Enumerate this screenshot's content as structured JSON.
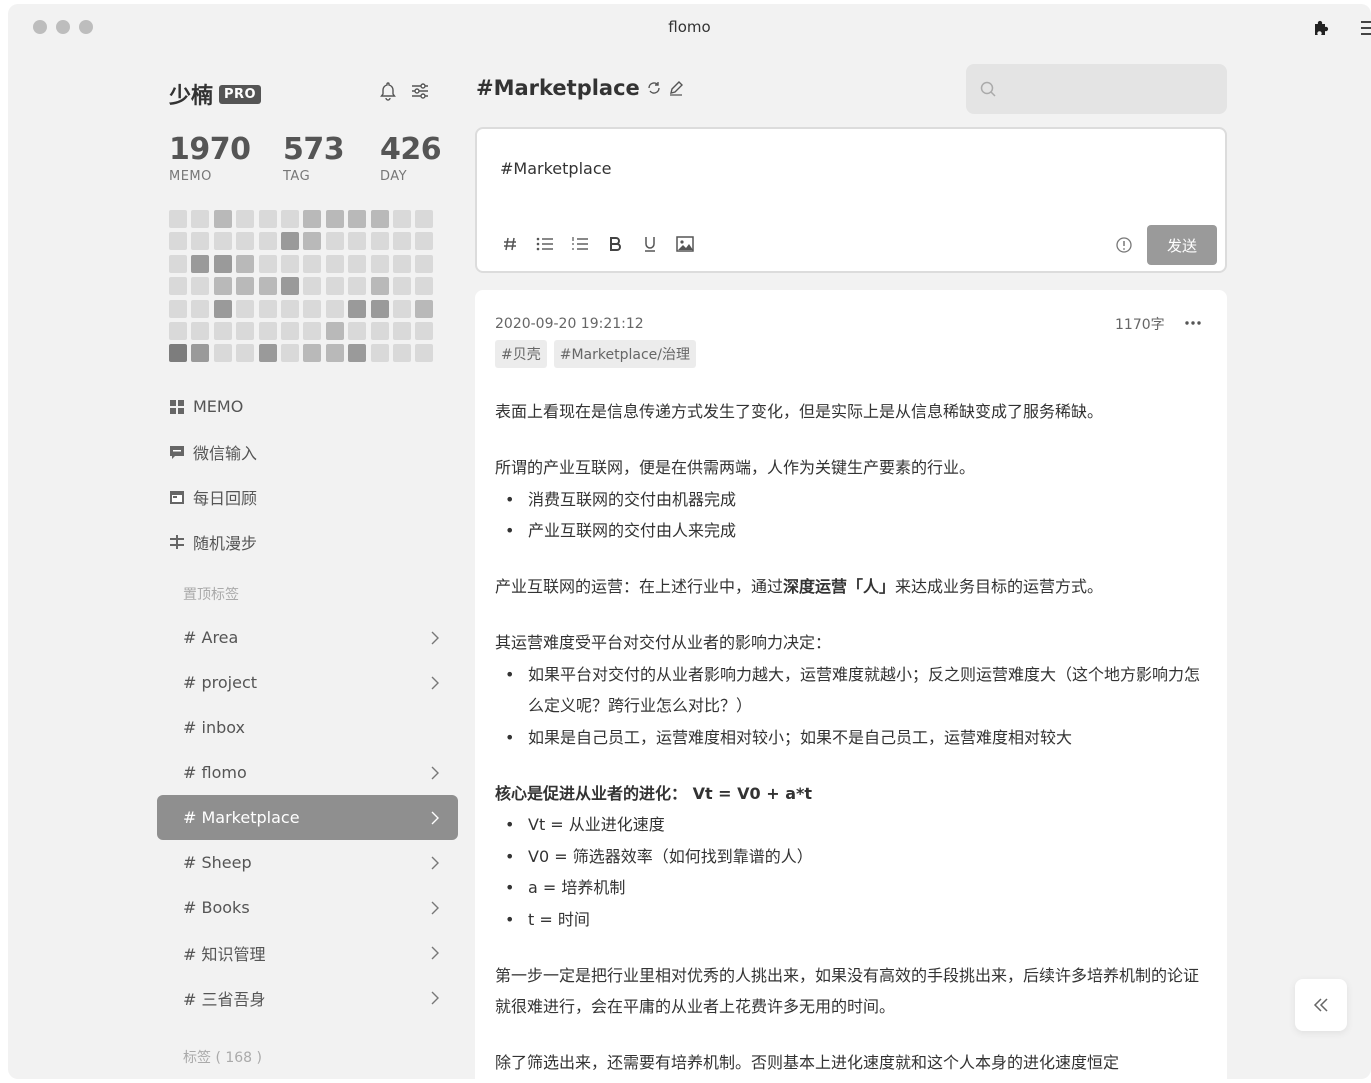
{
  "window": {
    "title": "flomo"
  },
  "sidebar": {
    "user_name": "少楠",
    "badge": "PRO",
    "stats": [
      {
        "value": "1970",
        "label": "MEMO"
      },
      {
        "value": "573",
        "label": "TAG"
      },
      {
        "value": "426",
        "label": "DAY"
      }
    ],
    "heatmap": {
      "colors": [
        "#e9e9e9",
        "#d9d9d9",
        "#b9b9b9",
        "#9a9a9a",
        "#7d7d7d"
      ],
      "levels": [
        [
          1,
          1,
          2,
          1,
          1,
          1,
          2,
          2,
          2,
          2,
          1,
          1
        ],
        [
          1,
          1,
          1,
          1,
          1,
          3,
          2,
          1,
          1,
          1,
          1,
          1
        ],
        [
          1,
          3,
          3,
          2,
          1,
          1,
          1,
          1,
          1,
          1,
          1,
          1
        ],
        [
          1,
          1,
          2,
          2,
          2,
          3,
          1,
          1,
          1,
          2,
          1,
          1
        ],
        [
          1,
          1,
          3,
          1,
          1,
          1,
          1,
          1,
          3,
          3,
          1,
          2
        ],
        [
          1,
          1,
          1,
          1,
          1,
          1,
          1,
          2,
          1,
          1,
          1,
          1
        ],
        [
          4,
          3,
          1,
          1,
          3,
          1,
          2,
          2,
          3,
          1,
          1,
          1
        ]
      ]
    },
    "nav": [
      {
        "label": "MEMO",
        "icon": "grid-icon"
      },
      {
        "label": "微信输入",
        "icon": "chat-icon"
      },
      {
        "label": "每日回顾",
        "icon": "calendar-icon"
      },
      {
        "label": "随机漫步",
        "icon": "shuffle-icon"
      }
    ],
    "pinned_label": "置顶标签",
    "tags": [
      {
        "label": "# Area",
        "has_children": true,
        "active": false
      },
      {
        "label": "# project",
        "has_children": true,
        "active": false
      },
      {
        "label": "# inbox",
        "has_children": false,
        "active": false
      },
      {
        "label": "# flomo",
        "has_children": true,
        "active": false
      },
      {
        "label": "# Marketplace",
        "has_children": true,
        "active": true
      },
      {
        "label": "# Sheep",
        "has_children": true,
        "active": false
      },
      {
        "label": "# Books",
        "has_children": true,
        "active": false
      },
      {
        "label": "# 知识管理",
        "has_children": true,
        "active": false
      },
      {
        "label": "# 三省吾身",
        "has_children": true,
        "active": false
      }
    ],
    "all_tags_label": "标签 ( 168 )"
  },
  "main": {
    "title": "#Marketplace",
    "search": {
      "placeholder": ""
    },
    "editor": {
      "content": "#Marketplace",
      "toolbar": [
        "hash",
        "bullet-list",
        "numbered-list",
        "bold",
        "underline",
        "image"
      ],
      "send_label": "发送"
    },
    "memo": {
      "time": "2020-09-20 19:21:12",
      "word_count": "1170字",
      "tags": [
        "#贝壳",
        "#Marketplace/治理"
      ],
      "p1": "表面上看现在是信息传递方式发生了变化，但是实际上是从信息稀缺变成了服务稀缺。",
      "p2": "所谓的产业互联网，便是在供需两端，人作为关键生产要素的行业。",
      "list1": [
        "消费互联网的交付由机器完成",
        "产业互联网的交付由人来完成"
      ],
      "p3_pre": "产业互联网的运营：在上述行业中，通过",
      "p3_bold": "深度运营「人」",
      "p3_post": "来达成业务目标的运营方式。",
      "p4": "其运营难度受平台对交付从业者的影响力决定：",
      "list2": [
        "如果平台对交付的从业者影响力越大，运营难度就越小；反之则运营难度大（这个地方影响力怎么定义呢？跨行业怎么对比？）",
        "如果是自己员工，运营难度相对较小；如果不是自己员工，运营难度相对较大"
      ],
      "p5": "核心是促进从业者的进化： Vt = V0 + a*t",
      "list3": [
        "Vt = 从业进化速度",
        "V0 = 筛选器效率（如何找到靠谱的人）",
        "a = 培养机制",
        "t = 时间"
      ],
      "p6": "第一步一定是把行业里相对优秀的人挑出来，如果没有高效的手段挑出来，后续许多培养机制的论证就很难进行，会在平庸的从业者上花费许多无用的时间。",
      "p7": "除了筛选出来，还需要有培养机制。否则基本上进化速度就和这个人本身的进化速度恒定"
    }
  }
}
